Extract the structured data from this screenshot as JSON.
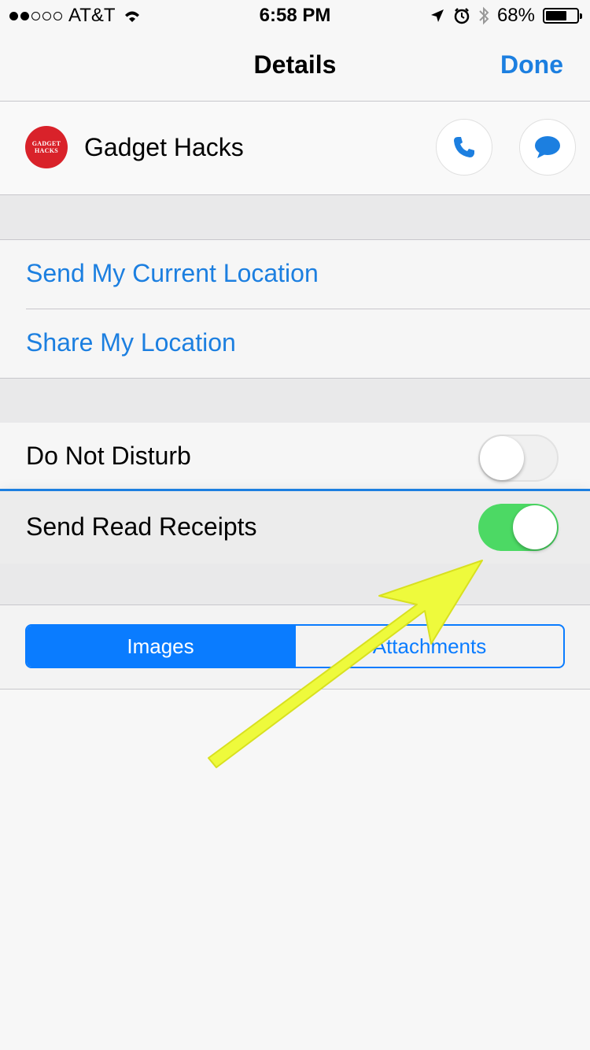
{
  "status_bar": {
    "carrier": "AT&T",
    "time": "6:58 PM",
    "battery": "68%",
    "battery_level": 0.68,
    "signal_bars_filled": 2,
    "signal_bars_total": 5
  },
  "nav": {
    "title": "Details",
    "done_label": "Done"
  },
  "contact": {
    "name": "Gadget Hacks",
    "avatar_line1": "GADGET",
    "avatar_line2": "HACKS"
  },
  "location": {
    "send_current": "Send My Current Location",
    "share": "Share My Location"
  },
  "settings": {
    "dnd_label": "Do Not Disturb",
    "dnd_on": false,
    "read_receipts_label": "Send Read Receipts",
    "read_receipts_on": true
  },
  "segment": {
    "images_label": "Images",
    "attachments_label": "Attachments",
    "selected": "Images"
  },
  "colors": {
    "accent": "#1c7fe0",
    "toggle_on": "#4cd964",
    "annotation_arrow": "#f0fa3c"
  }
}
